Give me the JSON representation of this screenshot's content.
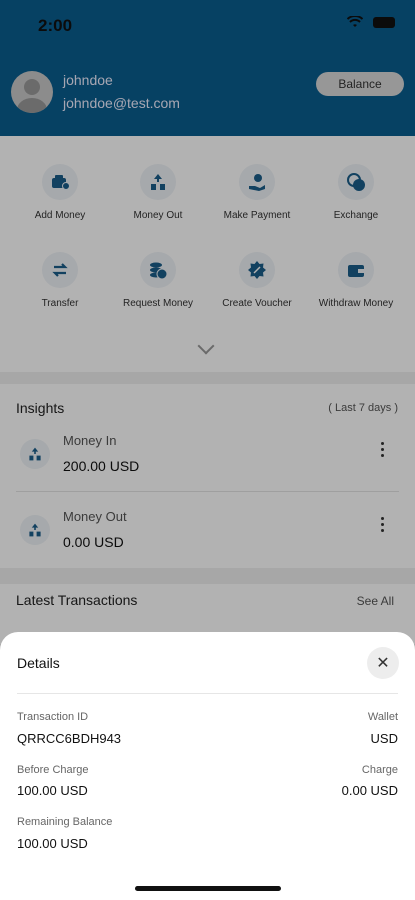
{
  "status_bar": {
    "time": "2:00"
  },
  "header": {
    "username": "johndoe",
    "email": "johndoe@test.com",
    "balance_button": "Balance"
  },
  "actions": [
    {
      "label": "Add Money",
      "icon": "wallet-plus-icon"
    },
    {
      "label": "Money Out",
      "icon": "money-out-icon"
    },
    {
      "label": "Make Payment",
      "icon": "payment-icon"
    },
    {
      "label": "Exchange",
      "icon": "exchange-icon"
    },
    {
      "label": "Transfer",
      "icon": "transfer-icon"
    },
    {
      "label": "Request Money",
      "icon": "request-money-icon"
    },
    {
      "label": "Create Voucher",
      "icon": "voucher-icon"
    },
    {
      "label": "Withdraw Money",
      "icon": "withdraw-icon"
    }
  ],
  "insights": {
    "title": "Insights",
    "period": "( Last 7 days )",
    "items": [
      {
        "label": "Money In",
        "value": "200.00 USD"
      },
      {
        "label": "Money Out",
        "value": "0.00 USD"
      }
    ]
  },
  "latest": {
    "title": "Latest Transactions",
    "see_all": "See All"
  },
  "details": {
    "title": "Details",
    "close_icon": "close-icon",
    "transaction_id_label": "Transaction ID",
    "transaction_id": "QRRCC6BDH943",
    "wallet_label": "Wallet",
    "wallet": "USD",
    "before_charge_label": "Before Charge",
    "before_charge": "100.00 USD",
    "charge_label": "Charge",
    "charge": "0.00 USD",
    "remaining_label": "Remaining Balance",
    "remaining": "100.00 USD"
  },
  "colors": {
    "header_bg": "#0a5d8f",
    "accent": "#1b5e8a"
  }
}
